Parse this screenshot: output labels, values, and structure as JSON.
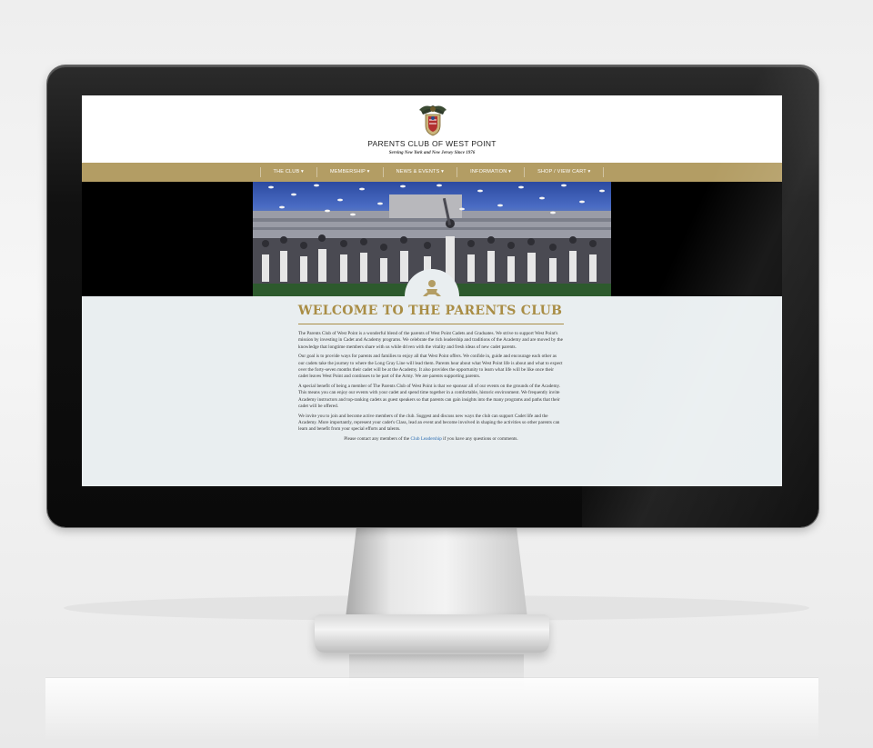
{
  "site": {
    "title": "PARENTS CLUB OF WEST POINT",
    "tagline": "Serving New York and New Jersey Since 1976"
  },
  "nav": {
    "items": [
      {
        "label": "THE CLUB ▾"
      },
      {
        "label": "MEMBERSHIP ▾"
      },
      {
        "label": "NEWS & EVENTS ▾"
      },
      {
        "label": "INFORMATION ▾"
      },
      {
        "label": "SHOP / VIEW CART ▾"
      }
    ]
  },
  "hero": {
    "badge_icon": "person-icon"
  },
  "welcome": {
    "heading": "WELCOME TO THE PARENTS CLUB",
    "paragraphs": [
      "The Parents Club of West Point is a wonderful blend of the parents of West Point Cadets and Graduates. We strive to support West Point's mission by investing in Cadet and Academy programs. We celebrate the rich leadership and traditions of the Academy and are moved by the knowledge that longtime members share with us while driven with the vitality and fresh ideas of new cadet parents.",
      "Our goal is to provide ways for parents and families to enjoy all that West Point offers. We confide in, guide and encourage each other as our cadets take the journey to where the Long Gray Line will lead them. Parents hear about what West Point life is about and what to expect over the forty-seven months their cadet will be at the Academy. It also provides the opportunity to learn what life will be like once their cadet leaves West Point and continues to be part of the Army. We are parents supporting parents.",
      "A special benefit of being a member of The Parents Club of West Point is that we sponsor all of our events on the grounds of the Academy. This means you can enjoy our events with your cadet and spend time together in a comfortable, historic environment. We frequently invite Academy instructors and top-ranking cadets as guest speakers so that parents can gain insights into the many programs and paths that their cadet will be offered.",
      "We invite you to join and become active members of the club. Suggest and discuss new ways the club can support Cadet life and the Academy. More importantly, represent your cadet's Class, lead an event and become involved in shaping the activities so other parents can learn and benefit from your special efforts and talents."
    ],
    "contact_prefix": "Please contact any members of the ",
    "contact_link": "Club Leadership",
    "contact_suffix": " if you have any questions or comments."
  },
  "colors": {
    "accent_gold": "#b39d64",
    "heading_gold": "#a98d45",
    "content_bg": "#e9eef0",
    "link_blue": "#2a6bb0"
  }
}
